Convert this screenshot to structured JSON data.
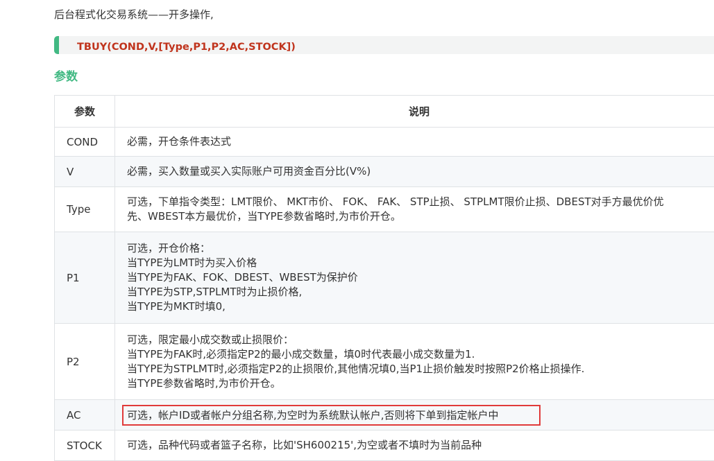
{
  "intro": "后台程式化交易系统——开多操作,",
  "code": "TBUY(COND,V,[Type,P1,P2,AC,STOCK])",
  "heading": "参数",
  "table": {
    "headers": [
      "参数",
      "说明"
    ],
    "rows": [
      {
        "param": "COND",
        "desc": [
          "必需，开仓条件表达式"
        ]
      },
      {
        "param": "V",
        "desc": [
          "必需，买入数量或买入实际账户可用资金百分比(V%)"
        ]
      },
      {
        "param": "Type",
        "desc": [
          "可选，下单指令类型：LMT限价、 MKT市价、 FOK、 FAK、 STP止损、 STPLMT限价止损、DBEST对手方最优价优",
          "先、WBEST本方最优价，当TYPE参数省略时,为市价开仓。"
        ]
      },
      {
        "param": "P1",
        "desc": [
          "可选，开仓价格：",
          "当TYPE为LMT时为买入价格",
          "当TYPE为FAK、FOK、DBEST、WBEST为保护价",
          "当TYPE为STP,STPLMT时为止损价格,",
          "当TYPE为MKT时填0,"
        ]
      },
      {
        "param": "P2",
        "desc": [
          "可选，限定最小成交数或止损限价：",
          "当TYPE为FAK时,必须指定P2的最小成交数量，填0时代表最小成交数量为1.",
          "当TYPE为STPLMT时,必须指定P2的止损限价,其他情况填0,当P1止损价触发时按照P2价格止损操作.",
          "当TYPE参数省略时,为市价开仓。"
        ]
      },
      {
        "param": "AC",
        "desc": [
          "可选，帐户ID或者帐户分组名称,为空时为系统默认帐户,否则将下单到指定帐户中"
        ]
      },
      {
        "param": "STOCK",
        "desc": [
          "可选，品种代码或者篮子名称，比如'SH600215',为空或者不填时为当前品种"
        ]
      }
    ]
  },
  "colors": {
    "accent": "#42b983",
    "code": "#c0341d",
    "highlight_box": "#e03a3a"
  }
}
